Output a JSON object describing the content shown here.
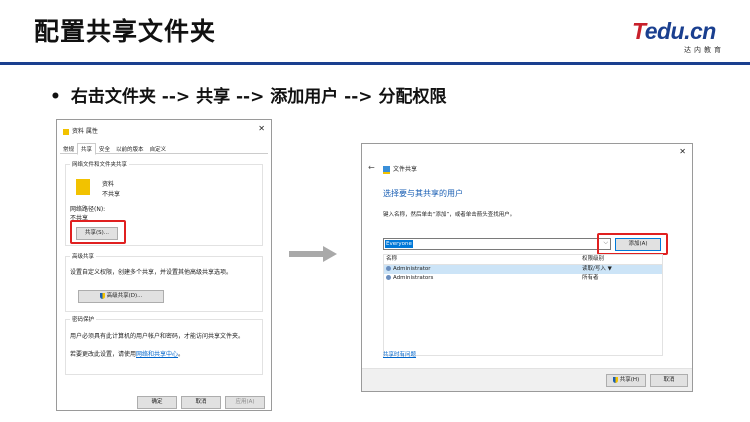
{
  "slide": {
    "title": "配置共享文件夹",
    "logo": {
      "main_t": "T",
      "main_rest": "edu.cn",
      "sub": "达内教育"
    },
    "bullet_dot": "•",
    "bullet": "右击文件夹 --> 共享 --> 添加用户 --> 分配权限"
  },
  "props_dialog": {
    "title": "资料 属性",
    "close": "✕",
    "tabs": [
      "常规",
      "共享",
      "安全",
      "以前的版本",
      "自定义"
    ],
    "share_group": {
      "label": "网络文件和文件夹共享",
      "folder_name": "资料",
      "folder_state": "不共享",
      "path_label": "网络路径(N):",
      "path_value": "不共享",
      "share_button": "共享(S)..."
    },
    "advanced_group": {
      "label": "高级共享",
      "desc": "设置自定义权限，创建多个共享，并设置其他高级共享选项。",
      "button": "高级共享(D)..."
    },
    "password_group": {
      "label": "密码保护",
      "desc": "用户必须具有此计算机的用户帐户和密码，才能访问共享文件夹。",
      "change_prefix": "若要更改此设置，请使用",
      "change_link": "网络和共享中心",
      "change_suffix": "。"
    },
    "buttons": {
      "ok": "确定",
      "cancel": "取消",
      "apply": "应用(A)"
    }
  },
  "share_dialog": {
    "close": "✕",
    "back": "←",
    "title": "文件共享",
    "heading": "选择要与其共享的用户",
    "instruction": "键入名称，然后单击“添加”，或者单击箭头查找用户。",
    "combo_value": "Everyone",
    "combo_arrow": "⌵",
    "add_button": "添加(A)",
    "columns": {
      "name": "名称",
      "permission": "权限级别"
    },
    "rows": [
      {
        "name": "Administrator",
        "permission": "读取/写入 ▼"
      },
      {
        "name": "Administrators",
        "permission": "所有者"
      }
    ],
    "help_link": "共享时有问题",
    "share_button": "共享(H)",
    "cancel_button": "取消"
  },
  "colors": {
    "brand_blue": "#1a3f8f",
    "highlight_red": "#e02020",
    "link_blue": "#0066cc",
    "select_blue": "#0078d7"
  }
}
